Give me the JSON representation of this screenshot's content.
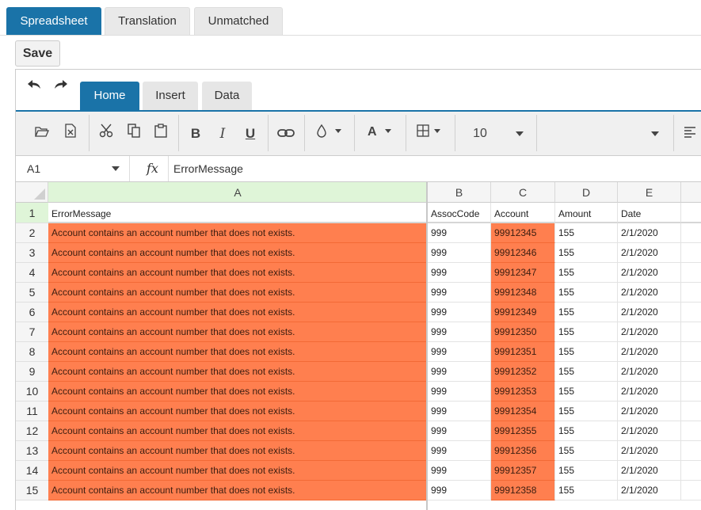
{
  "top_tabs": [
    "Spreadsheet",
    "Translation",
    "Unmatched"
  ],
  "save_label": "Save",
  "ribbon_tabs": [
    "Home",
    "Insert",
    "Data"
  ],
  "toolbar": {
    "font_size": "10",
    "icons": [
      "open-icon",
      "export-excel-icon",
      "cut-icon",
      "copy-icon",
      "paste-icon",
      "bold-icon",
      "italic-icon",
      "underline-icon",
      "link-icon",
      "fill-color-icon",
      "text-color-icon",
      "borders-icon",
      "align-left-icon"
    ]
  },
  "formula_bar": {
    "cell_ref": "A1",
    "fx": "fx",
    "value": "ErrorMessage"
  },
  "columns": [
    "A",
    "B",
    "C",
    "D",
    "E"
  ],
  "header_row": {
    "num": "1",
    "cells": [
      "ErrorMessage",
      "AssocCode",
      "Account",
      "Amount",
      "Date"
    ]
  },
  "rows": [
    {
      "num": "2",
      "cells": [
        "Account contains an account number that does not exists.",
        "999",
        "99912345",
        "155",
        "2/1/2020"
      ]
    },
    {
      "num": "3",
      "cells": [
        "Account contains an account number that does not exists.",
        "999",
        "99912346",
        "155",
        "2/1/2020"
      ]
    },
    {
      "num": "4",
      "cells": [
        "Account contains an account number that does not exists.",
        "999",
        "99912347",
        "155",
        "2/1/2020"
      ]
    },
    {
      "num": "5",
      "cells": [
        "Account contains an account number that does not exists.",
        "999",
        "99912348",
        "155",
        "2/1/2020"
      ]
    },
    {
      "num": "6",
      "cells": [
        "Account contains an account number that does not exists.",
        "999",
        "99912349",
        "155",
        "2/1/2020"
      ]
    },
    {
      "num": "7",
      "cells": [
        "Account contains an account number that does not exists.",
        "999",
        "99912350",
        "155",
        "2/1/2020"
      ]
    },
    {
      "num": "8",
      "cells": [
        "Account contains an account number that does not exists.",
        "999",
        "99912351",
        "155",
        "2/1/2020"
      ]
    },
    {
      "num": "9",
      "cells": [
        "Account contains an account number that does not exists.",
        "999",
        "99912352",
        "155",
        "2/1/2020"
      ]
    },
    {
      "num": "10",
      "cells": [
        "Account contains an account number that does not exists.",
        "999",
        "99912353",
        "155",
        "2/1/2020"
      ]
    },
    {
      "num": "11",
      "cells": [
        "Account contains an account number that does not exists.",
        "999",
        "99912354",
        "155",
        "2/1/2020"
      ]
    },
    {
      "num": "12",
      "cells": [
        "Account contains an account number that does not exists.",
        "999",
        "99912355",
        "155",
        "2/1/2020"
      ]
    },
    {
      "num": "13",
      "cells": [
        "Account contains an account number that does not exists.",
        "999",
        "99912356",
        "155",
        "2/1/2020"
      ]
    },
    {
      "num": "14",
      "cells": [
        "Account contains an account number that does not exists.",
        "999",
        "99912357",
        "155",
        "2/1/2020"
      ]
    },
    {
      "num": "15",
      "cells": [
        "Account contains an account number that does not exists.",
        "999",
        "99912358",
        "155",
        "2/1/2020"
      ]
    }
  ],
  "colors": {
    "accent": "#1a73a8",
    "error_fill": "#ff7f4f",
    "selected_header": "#dff5d8"
  }
}
